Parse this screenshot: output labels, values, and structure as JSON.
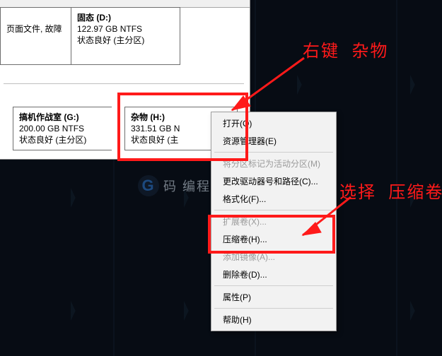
{
  "disks": {
    "row1": {
      "left": {
        "line1": "",
        "line2": "页面文件, 故障"
      },
      "right": {
        "title": "固态   (D:)",
        "size": "122.97 GB NTFS",
        "status": "状态良好 (主分区)"
      }
    },
    "row2": {
      "left": {
        "title": "搞机作战室   (G:)",
        "size": "200.00 GB NTFS",
        "status": "状态良好 (主分区)"
      },
      "right": {
        "title": "杂物   (H:)",
        "size": "331.51 GB N",
        "status": "状态良好 (主"
      }
    }
  },
  "menu": {
    "open": "打开(O)",
    "explorer": "资源管理器(E)",
    "mark_active": "将分区标记为活动分区(M)",
    "change_letter": "更改驱动器号和路径(C)...",
    "format": "格式化(F)...",
    "extend": "扩展卷(X)...",
    "shrink": "压缩卷(H)...",
    "add_mirror": "添加镜像(A)...",
    "delete": "删除卷(D)...",
    "properties": "属性(P)",
    "help": "帮助(H)"
  },
  "callouts": {
    "c1a": "右键",
    "c1b": "杂物",
    "c2a": "选择",
    "c2b": "压缩卷"
  },
  "watermark": {
    "logo": "G",
    "text": "码 编程"
  }
}
